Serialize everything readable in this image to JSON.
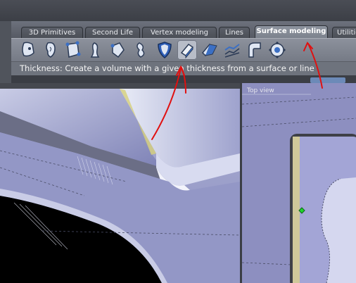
{
  "tabs": [
    {
      "label": "3D Primitives",
      "active": false
    },
    {
      "label": "Second Life",
      "active": false
    },
    {
      "label": "Vertex modeling",
      "active": false
    },
    {
      "label": "Lines",
      "active": false
    },
    {
      "label": "Surface modeling",
      "active": true
    },
    {
      "label": "Utilities",
      "active": false
    }
  ],
  "tools": [
    {
      "icon": "surface-skin-icon"
    },
    {
      "icon": "surface-ear-icon"
    },
    {
      "icon": "surface-loft-icon"
    },
    {
      "icon": "surface-extrude-icon"
    },
    {
      "icon": "surface-sweep-icon"
    },
    {
      "icon": "surface-revolve-icon"
    },
    {
      "icon": "surface-shield-icon"
    },
    {
      "icon": "thickness-icon"
    },
    {
      "icon": "surface-fold-icon"
    },
    {
      "icon": "surface-steps-icon"
    },
    {
      "icon": "surface-fillet-icon"
    },
    {
      "icon": "surface-gear-icon"
    }
  ],
  "status": {
    "text": "Thickness: Create a volume with a given thickness from a surface or line"
  },
  "viewports": {
    "top_label": "Top view"
  },
  "colors": {
    "annotation": "#e01010",
    "frame_border": "#d42020",
    "surface": "#9a9ec9"
  }
}
